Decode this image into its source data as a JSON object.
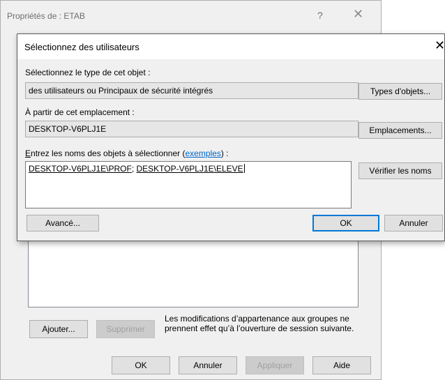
{
  "background_window": {
    "title": "Propriétés de : ETAB",
    "help_glyph": "?",
    "close_glyph": "✕",
    "add_button": "Ajouter...",
    "remove_button": "Supprimer",
    "note": "Les modifications d’appartenance aux groupes ne prennent effet qu’à l’ouverture de session suivante.",
    "ok_button": "OK",
    "cancel_button": "Annuler",
    "apply_button": "Appliquer",
    "help_button": "Aide"
  },
  "dialog": {
    "title": "Sélectionnez des utilisateurs",
    "close_glyph": "✕",
    "object_type_label": "Sélectionnez le type de cet objet :",
    "object_type_value": "des utilisateurs ou Principaux de sécurité intégrés",
    "object_types_button": "Types d'objets...",
    "location_label": "À partir de cet emplacement :",
    "location_value": "DESKTOP-V6PLJ1E",
    "locations_button": "Emplacements...",
    "names_label_prefix": "ntrez les noms des objets à sélectionner (",
    "names_label_mnemonic": "E",
    "names_label_link": "exemples",
    "names_label_suffix": ") :",
    "names_entry_1": "DESKTOP-V6PLJ1E\\PROF",
    "names_separator": "; ",
    "names_entry_2": "DESKTOP-V6PLJ1E\\ELEVE",
    "check_names_button": "Vérifier les noms",
    "advanced_button": "Avancé...",
    "ok_button": "OK",
    "cancel_button": "Annuler"
  },
  "colors": {
    "accent": "#0078d7",
    "link": "#0066cc",
    "window_bg": "#f0f0f0"
  }
}
